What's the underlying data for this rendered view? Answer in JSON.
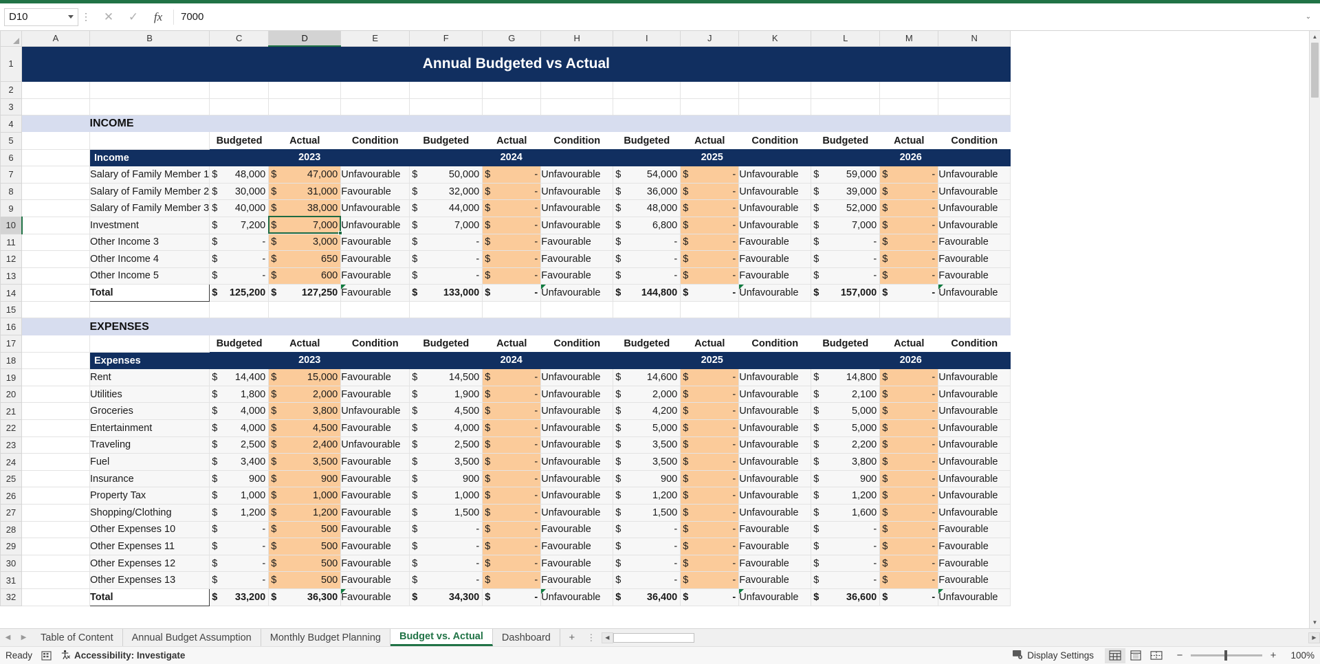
{
  "formula_bar": {
    "name_box": "D10",
    "formula_value": "7000",
    "cancel_icon": "cancel-x-icon",
    "confirm_icon": "confirm-check-icon",
    "fx_icon": "fx-icon"
  },
  "columns": [
    "A",
    "B",
    "C",
    "D",
    "E",
    "F",
    "G",
    "H",
    "I",
    "J",
    "K",
    "L",
    "M",
    "N"
  ],
  "selected_column": "D",
  "selected_row": 10,
  "rows": [
    1,
    2,
    3,
    4,
    5,
    6,
    7,
    8,
    9,
    10,
    11,
    12,
    13,
    14,
    15,
    16,
    17,
    18,
    19,
    20,
    21,
    22,
    23,
    24,
    25,
    26,
    27,
    28,
    29,
    30,
    31,
    32
  ],
  "sheet": {
    "title": "Annual Budgeted vs Actual",
    "income_section_label": "INCOME",
    "expenses_section_label": "EXPENSES",
    "col_headers": [
      "Budgeted",
      "Actual",
      "Condition"
    ],
    "years": [
      "2023",
      "2024",
      "2025",
      "2026"
    ],
    "income_header_label": "Income",
    "expenses_header_label": "Expenses",
    "total_label": "Total",
    "currency_symbol": "$",
    "dash": "-",
    "favourable": "Favourable",
    "unfavourable": "Unfavourable",
    "income_rows": [
      {
        "name": "Salary of Family Member 1",
        "y2023": {
          "budget": "48,000",
          "actual": "47,000",
          "cond": "Unfavourable"
        },
        "y2024": {
          "budget": "50,000",
          "actual": "-",
          "cond": "Unfavourable"
        },
        "y2025": {
          "budget": "54,000",
          "actual": "-",
          "cond": "Unfavourable"
        },
        "y2026": {
          "budget": "59,000",
          "actual": "-",
          "cond": "Unfavourable"
        }
      },
      {
        "name": "Salary of Family Member 2",
        "y2023": {
          "budget": "30,000",
          "actual": "31,000",
          "cond": "Favourable"
        },
        "y2024": {
          "budget": "32,000",
          "actual": "-",
          "cond": "Unfavourable"
        },
        "y2025": {
          "budget": "36,000",
          "actual": "-",
          "cond": "Unfavourable"
        },
        "y2026": {
          "budget": "39,000",
          "actual": "-",
          "cond": "Unfavourable"
        }
      },
      {
        "name": "Salary of Family Member 3",
        "y2023": {
          "budget": "40,000",
          "actual": "38,000",
          "cond": "Unfavourable"
        },
        "y2024": {
          "budget": "44,000",
          "actual": "-",
          "cond": "Unfavourable"
        },
        "y2025": {
          "budget": "48,000",
          "actual": "-",
          "cond": "Unfavourable"
        },
        "y2026": {
          "budget": "52,000",
          "actual": "-",
          "cond": "Unfavourable"
        }
      },
      {
        "name": "Investment",
        "y2023": {
          "budget": "7,200",
          "actual": "7,000",
          "cond": "Unfavourable"
        },
        "y2024": {
          "budget": "7,000",
          "actual": "-",
          "cond": "Unfavourable"
        },
        "y2025": {
          "budget": "6,800",
          "actual": "-",
          "cond": "Unfavourable"
        },
        "y2026": {
          "budget": "7,000",
          "actual": "-",
          "cond": "Unfavourable"
        }
      },
      {
        "name": "Other Income 3",
        "y2023": {
          "budget": "-",
          "actual": "3,000",
          "cond": "Favourable"
        },
        "y2024": {
          "budget": "-",
          "actual": "-",
          "cond": "Favourable"
        },
        "y2025": {
          "budget": "-",
          "actual": "-",
          "cond": "Favourable"
        },
        "y2026": {
          "budget": "-",
          "actual": "-",
          "cond": "Favourable"
        }
      },
      {
        "name": "Other Income 4",
        "y2023": {
          "budget": "-",
          "actual": "650",
          "cond": "Favourable"
        },
        "y2024": {
          "budget": "-",
          "actual": "-",
          "cond": "Favourable"
        },
        "y2025": {
          "budget": "-",
          "actual": "-",
          "cond": "Favourable"
        },
        "y2026": {
          "budget": "-",
          "actual": "-",
          "cond": "Favourable"
        }
      },
      {
        "name": "Other Income 5",
        "y2023": {
          "budget": "-",
          "actual": "600",
          "cond": "Favourable"
        },
        "y2024": {
          "budget": "-",
          "actual": "-",
          "cond": "Favourable"
        },
        "y2025": {
          "budget": "-",
          "actual": "-",
          "cond": "Favourable"
        },
        "y2026": {
          "budget": "-",
          "actual": "-",
          "cond": "Favourable"
        }
      }
    ],
    "income_total": {
      "name": "Total",
      "y2023": {
        "budget": "125,200",
        "actual": "127,250",
        "cond": "Favourable"
      },
      "y2024": {
        "budget": "133,000",
        "actual": "-",
        "cond": "Unfavourable"
      },
      "y2025": {
        "budget": "144,800",
        "actual": "-",
        "cond": "Unfavourable"
      },
      "y2026": {
        "budget": "157,000",
        "actual": "-",
        "cond": "Unfavourable"
      }
    },
    "expense_rows": [
      {
        "name": "Rent",
        "y2023": {
          "budget": "14,400",
          "actual": "15,000",
          "cond": "Favourable"
        },
        "y2024": {
          "budget": "14,500",
          "actual": "-",
          "cond": "Unfavourable"
        },
        "y2025": {
          "budget": "14,600",
          "actual": "-",
          "cond": "Unfavourable"
        },
        "y2026": {
          "budget": "14,800",
          "actual": "-",
          "cond": "Unfavourable"
        }
      },
      {
        "name": "Utilities",
        "y2023": {
          "budget": "1,800",
          "actual": "2,000",
          "cond": "Favourable"
        },
        "y2024": {
          "budget": "1,900",
          "actual": "-",
          "cond": "Unfavourable"
        },
        "y2025": {
          "budget": "2,000",
          "actual": "-",
          "cond": "Unfavourable"
        },
        "y2026": {
          "budget": "2,100",
          "actual": "-",
          "cond": "Unfavourable"
        }
      },
      {
        "name": "Groceries",
        "y2023": {
          "budget": "4,000",
          "actual": "3,800",
          "cond": "Unfavourable"
        },
        "y2024": {
          "budget": "4,500",
          "actual": "-",
          "cond": "Unfavourable"
        },
        "y2025": {
          "budget": "4,200",
          "actual": "-",
          "cond": "Unfavourable"
        },
        "y2026": {
          "budget": "5,000",
          "actual": "-",
          "cond": "Unfavourable"
        }
      },
      {
        "name": "Entertainment",
        "y2023": {
          "budget": "4,000",
          "actual": "4,500",
          "cond": "Favourable"
        },
        "y2024": {
          "budget": "4,000",
          "actual": "-",
          "cond": "Unfavourable"
        },
        "y2025": {
          "budget": "5,000",
          "actual": "-",
          "cond": "Unfavourable"
        },
        "y2026": {
          "budget": "5,000",
          "actual": "-",
          "cond": "Unfavourable"
        }
      },
      {
        "name": "Traveling",
        "y2023": {
          "budget": "2,500",
          "actual": "2,400",
          "cond": "Unfavourable"
        },
        "y2024": {
          "budget": "2,500",
          "actual": "-",
          "cond": "Unfavourable"
        },
        "y2025": {
          "budget": "3,500",
          "actual": "-",
          "cond": "Unfavourable"
        },
        "y2026": {
          "budget": "2,200",
          "actual": "-",
          "cond": "Unfavourable"
        }
      },
      {
        "name": "Fuel",
        "y2023": {
          "budget": "3,400",
          "actual": "3,500",
          "cond": "Favourable"
        },
        "y2024": {
          "budget": "3,500",
          "actual": "-",
          "cond": "Unfavourable"
        },
        "y2025": {
          "budget": "3,500",
          "actual": "-",
          "cond": "Unfavourable"
        },
        "y2026": {
          "budget": "3,800",
          "actual": "-",
          "cond": "Unfavourable"
        }
      },
      {
        "name": "Insurance",
        "y2023": {
          "budget": "900",
          "actual": "900",
          "cond": "Favourable"
        },
        "y2024": {
          "budget": "900",
          "actual": "-",
          "cond": "Unfavourable"
        },
        "y2025": {
          "budget": "900",
          "actual": "-",
          "cond": "Unfavourable"
        },
        "y2026": {
          "budget": "900",
          "actual": "-",
          "cond": "Unfavourable"
        }
      },
      {
        "name": "Property Tax",
        "y2023": {
          "budget": "1,000",
          "actual": "1,000",
          "cond": "Favourable"
        },
        "y2024": {
          "budget": "1,000",
          "actual": "-",
          "cond": "Unfavourable"
        },
        "y2025": {
          "budget": "1,200",
          "actual": "-",
          "cond": "Unfavourable"
        },
        "y2026": {
          "budget": "1,200",
          "actual": "-",
          "cond": "Unfavourable"
        }
      },
      {
        "name": "Shopping/Clothing",
        "y2023": {
          "budget": "1,200",
          "actual": "1,200",
          "cond": "Favourable"
        },
        "y2024": {
          "budget": "1,500",
          "actual": "-",
          "cond": "Unfavourable"
        },
        "y2025": {
          "budget": "1,500",
          "actual": "-",
          "cond": "Unfavourable"
        },
        "y2026": {
          "budget": "1,600",
          "actual": "-",
          "cond": "Unfavourable"
        }
      },
      {
        "name": "Other Expenses 10",
        "y2023": {
          "budget": "-",
          "actual": "500",
          "cond": "Favourable"
        },
        "y2024": {
          "budget": "-",
          "actual": "-",
          "cond": "Favourable"
        },
        "y2025": {
          "budget": "-",
          "actual": "-",
          "cond": "Favourable"
        },
        "y2026": {
          "budget": "-",
          "actual": "-",
          "cond": "Favourable"
        }
      },
      {
        "name": "Other Expenses 11",
        "y2023": {
          "budget": "-",
          "actual": "500",
          "cond": "Favourable"
        },
        "y2024": {
          "budget": "-",
          "actual": "-",
          "cond": "Favourable"
        },
        "y2025": {
          "budget": "-",
          "actual": "-",
          "cond": "Favourable"
        },
        "y2026": {
          "budget": "-",
          "actual": "-",
          "cond": "Favourable"
        }
      },
      {
        "name": "Other Expenses 12",
        "y2023": {
          "budget": "-",
          "actual": "500",
          "cond": "Favourable"
        },
        "y2024": {
          "budget": "-",
          "actual": "-",
          "cond": "Favourable"
        },
        "y2025": {
          "budget": "-",
          "actual": "-",
          "cond": "Favourable"
        },
        "y2026": {
          "budget": "-",
          "actual": "-",
          "cond": "Favourable"
        }
      },
      {
        "name": "Other Expenses 13",
        "y2023": {
          "budget": "-",
          "actual": "500",
          "cond": "Favourable"
        },
        "y2024": {
          "budget": "-",
          "actual": "-",
          "cond": "Favourable"
        },
        "y2025": {
          "budget": "-",
          "actual": "-",
          "cond": "Favourable"
        },
        "y2026": {
          "budget": "-",
          "actual": "-",
          "cond": "Favourable"
        }
      }
    ],
    "expense_total": {
      "name": "Total",
      "y2023": {
        "budget": "33,200",
        "actual": "36,300",
        "cond": "Favourable"
      },
      "y2024": {
        "budget": "34,300",
        "actual": "-",
        "cond": "Unfavourable"
      },
      "y2025": {
        "budget": "36,400",
        "actual": "-",
        "cond": "Unfavourable"
      },
      "y2026": {
        "budget": "36,600",
        "actual": "-",
        "cond": "Unfavourable"
      }
    }
  },
  "tabs": [
    {
      "label": "Table of Content",
      "active": false
    },
    {
      "label": "Annual Budget Assumption",
      "active": false
    },
    {
      "label": "Monthly Budget Planning",
      "active": false
    },
    {
      "label": "Budget vs. Actual",
      "active": true
    },
    {
      "label": "Dashboard",
      "active": false
    }
  ],
  "tab_add_label": "+",
  "status": {
    "ready": "Ready",
    "accessibility": "Accessibility: Investigate",
    "display_settings": "Display Settings",
    "zoom": "100%",
    "views": [
      "normal-view",
      "page-layout-view",
      "page-break-view"
    ]
  }
}
